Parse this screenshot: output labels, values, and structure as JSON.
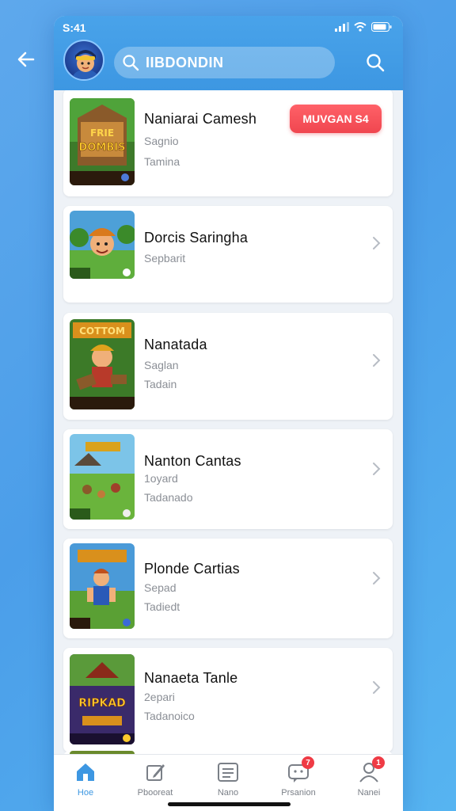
{
  "status": {
    "time": "S:41"
  },
  "search": {
    "text": "IIBDONDIN"
  },
  "cards": [
    {
      "title": "Naniarai Camesh",
      "line1": "Sagnio",
      "line2": "Tamina",
      "action": "MUVGAN S4"
    },
    {
      "title": "Dorcis Saringha",
      "line1": "Sepbarit"
    },
    {
      "title": "Nanatada",
      "line1": "Saglan",
      "line2": "Tadain"
    },
    {
      "title": "Nanton Cantas",
      "line1": "1oyard",
      "line2": "Tadanado"
    },
    {
      "title": "Plonde Cartias",
      "line1": "Sepad",
      "line2": "Tadiedt"
    },
    {
      "title": "Nanaeta Tanle",
      "line1": "2epari",
      "line2": "Tadanoico"
    }
  ],
  "thumbs": [
    {
      "top_text": "FRIE",
      "main_text": "DOMBIS"
    },
    {
      "top_text": ""
    },
    {
      "top_text": "COTTOM"
    },
    {
      "top_text": ""
    },
    {
      "top_text": ""
    },
    {
      "top_text": "",
      "main_text": "RIPKAD"
    }
  ],
  "tabs": [
    {
      "label": "Hoe",
      "icon": "home-icon"
    },
    {
      "label": "Pbooreat",
      "icon": "edit-icon"
    },
    {
      "label": "Nano",
      "icon": "list-icon"
    },
    {
      "label": "Prsanion",
      "icon": "chat-icon",
      "badge": "7"
    },
    {
      "label": "Nanei",
      "icon": "profile-icon",
      "badge": "1"
    }
  ],
  "colors": {
    "accent": "#3d97e2",
    "cta": "#f0464f",
    "badge": "#ef3b45"
  }
}
